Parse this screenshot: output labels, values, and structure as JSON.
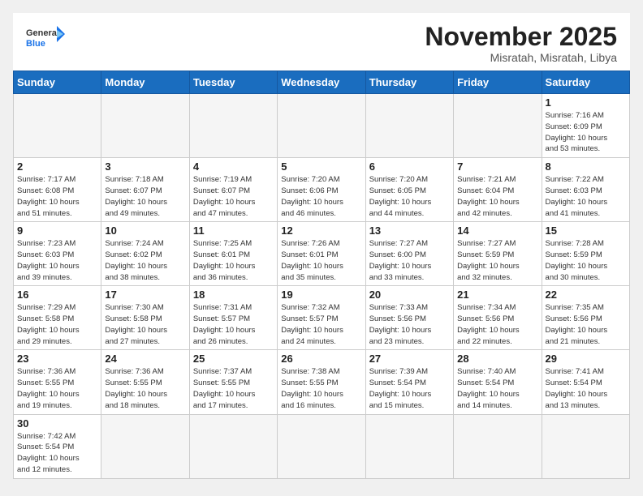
{
  "header": {
    "logo_general": "General",
    "logo_blue": "Blue",
    "month_year": "November 2025",
    "location": "Misratah, Misratah, Libya"
  },
  "weekdays": [
    "Sunday",
    "Monday",
    "Tuesday",
    "Wednesday",
    "Thursday",
    "Friday",
    "Saturday"
  ],
  "days": [
    {
      "num": "",
      "info": "",
      "empty": true
    },
    {
      "num": "",
      "info": "",
      "empty": true
    },
    {
      "num": "",
      "info": "",
      "empty": true
    },
    {
      "num": "",
      "info": "",
      "empty": true
    },
    {
      "num": "",
      "info": "",
      "empty": true
    },
    {
      "num": "",
      "info": "",
      "empty": true
    },
    {
      "num": "1",
      "info": "Sunrise: 7:16 AM\nSunset: 6:09 PM\nDaylight: 10 hours\nand 53 minutes."
    },
    {
      "num": "2",
      "info": "Sunrise: 7:17 AM\nSunset: 6:08 PM\nDaylight: 10 hours\nand 51 minutes."
    },
    {
      "num": "3",
      "info": "Sunrise: 7:18 AM\nSunset: 6:07 PM\nDaylight: 10 hours\nand 49 minutes."
    },
    {
      "num": "4",
      "info": "Sunrise: 7:19 AM\nSunset: 6:07 PM\nDaylight: 10 hours\nand 47 minutes."
    },
    {
      "num": "5",
      "info": "Sunrise: 7:20 AM\nSunset: 6:06 PM\nDaylight: 10 hours\nand 46 minutes."
    },
    {
      "num": "6",
      "info": "Sunrise: 7:20 AM\nSunset: 6:05 PM\nDaylight: 10 hours\nand 44 minutes."
    },
    {
      "num": "7",
      "info": "Sunrise: 7:21 AM\nSunset: 6:04 PM\nDaylight: 10 hours\nand 42 minutes."
    },
    {
      "num": "8",
      "info": "Sunrise: 7:22 AM\nSunset: 6:03 PM\nDaylight: 10 hours\nand 41 minutes."
    },
    {
      "num": "9",
      "info": "Sunrise: 7:23 AM\nSunset: 6:03 PM\nDaylight: 10 hours\nand 39 minutes."
    },
    {
      "num": "10",
      "info": "Sunrise: 7:24 AM\nSunset: 6:02 PM\nDaylight: 10 hours\nand 38 minutes."
    },
    {
      "num": "11",
      "info": "Sunrise: 7:25 AM\nSunset: 6:01 PM\nDaylight: 10 hours\nand 36 minutes."
    },
    {
      "num": "12",
      "info": "Sunrise: 7:26 AM\nSunset: 6:01 PM\nDaylight: 10 hours\nand 35 minutes."
    },
    {
      "num": "13",
      "info": "Sunrise: 7:27 AM\nSunset: 6:00 PM\nDaylight: 10 hours\nand 33 minutes."
    },
    {
      "num": "14",
      "info": "Sunrise: 7:27 AM\nSunset: 5:59 PM\nDaylight: 10 hours\nand 32 minutes."
    },
    {
      "num": "15",
      "info": "Sunrise: 7:28 AM\nSunset: 5:59 PM\nDaylight: 10 hours\nand 30 minutes."
    },
    {
      "num": "16",
      "info": "Sunrise: 7:29 AM\nSunset: 5:58 PM\nDaylight: 10 hours\nand 29 minutes."
    },
    {
      "num": "17",
      "info": "Sunrise: 7:30 AM\nSunset: 5:58 PM\nDaylight: 10 hours\nand 27 minutes."
    },
    {
      "num": "18",
      "info": "Sunrise: 7:31 AM\nSunset: 5:57 PM\nDaylight: 10 hours\nand 26 minutes."
    },
    {
      "num": "19",
      "info": "Sunrise: 7:32 AM\nSunset: 5:57 PM\nDaylight: 10 hours\nand 24 minutes."
    },
    {
      "num": "20",
      "info": "Sunrise: 7:33 AM\nSunset: 5:56 PM\nDaylight: 10 hours\nand 23 minutes."
    },
    {
      "num": "21",
      "info": "Sunrise: 7:34 AM\nSunset: 5:56 PM\nDaylight: 10 hours\nand 22 minutes."
    },
    {
      "num": "22",
      "info": "Sunrise: 7:35 AM\nSunset: 5:56 PM\nDaylight: 10 hours\nand 21 minutes."
    },
    {
      "num": "23",
      "info": "Sunrise: 7:36 AM\nSunset: 5:55 PM\nDaylight: 10 hours\nand 19 minutes."
    },
    {
      "num": "24",
      "info": "Sunrise: 7:36 AM\nSunset: 5:55 PM\nDaylight: 10 hours\nand 18 minutes."
    },
    {
      "num": "25",
      "info": "Sunrise: 7:37 AM\nSunset: 5:55 PM\nDaylight: 10 hours\nand 17 minutes."
    },
    {
      "num": "26",
      "info": "Sunrise: 7:38 AM\nSunset: 5:55 PM\nDaylight: 10 hours\nand 16 minutes."
    },
    {
      "num": "27",
      "info": "Sunrise: 7:39 AM\nSunset: 5:54 PM\nDaylight: 10 hours\nand 15 minutes."
    },
    {
      "num": "28",
      "info": "Sunrise: 7:40 AM\nSunset: 5:54 PM\nDaylight: 10 hours\nand 14 minutes."
    },
    {
      "num": "29",
      "info": "Sunrise: 7:41 AM\nSunset: 5:54 PM\nDaylight: 10 hours\nand 13 minutes."
    },
    {
      "num": "30",
      "info": "Sunrise: 7:42 AM\nSunset: 5:54 PM\nDaylight: 10 hours\nand 12 minutes."
    },
    {
      "num": "",
      "info": "",
      "empty": true
    },
    {
      "num": "",
      "info": "",
      "empty": true
    },
    {
      "num": "",
      "info": "",
      "empty": true
    },
    {
      "num": "",
      "info": "",
      "empty": true
    },
    {
      "num": "",
      "info": "",
      "empty": true
    },
    {
      "num": "",
      "info": "",
      "empty": true
    }
  ]
}
